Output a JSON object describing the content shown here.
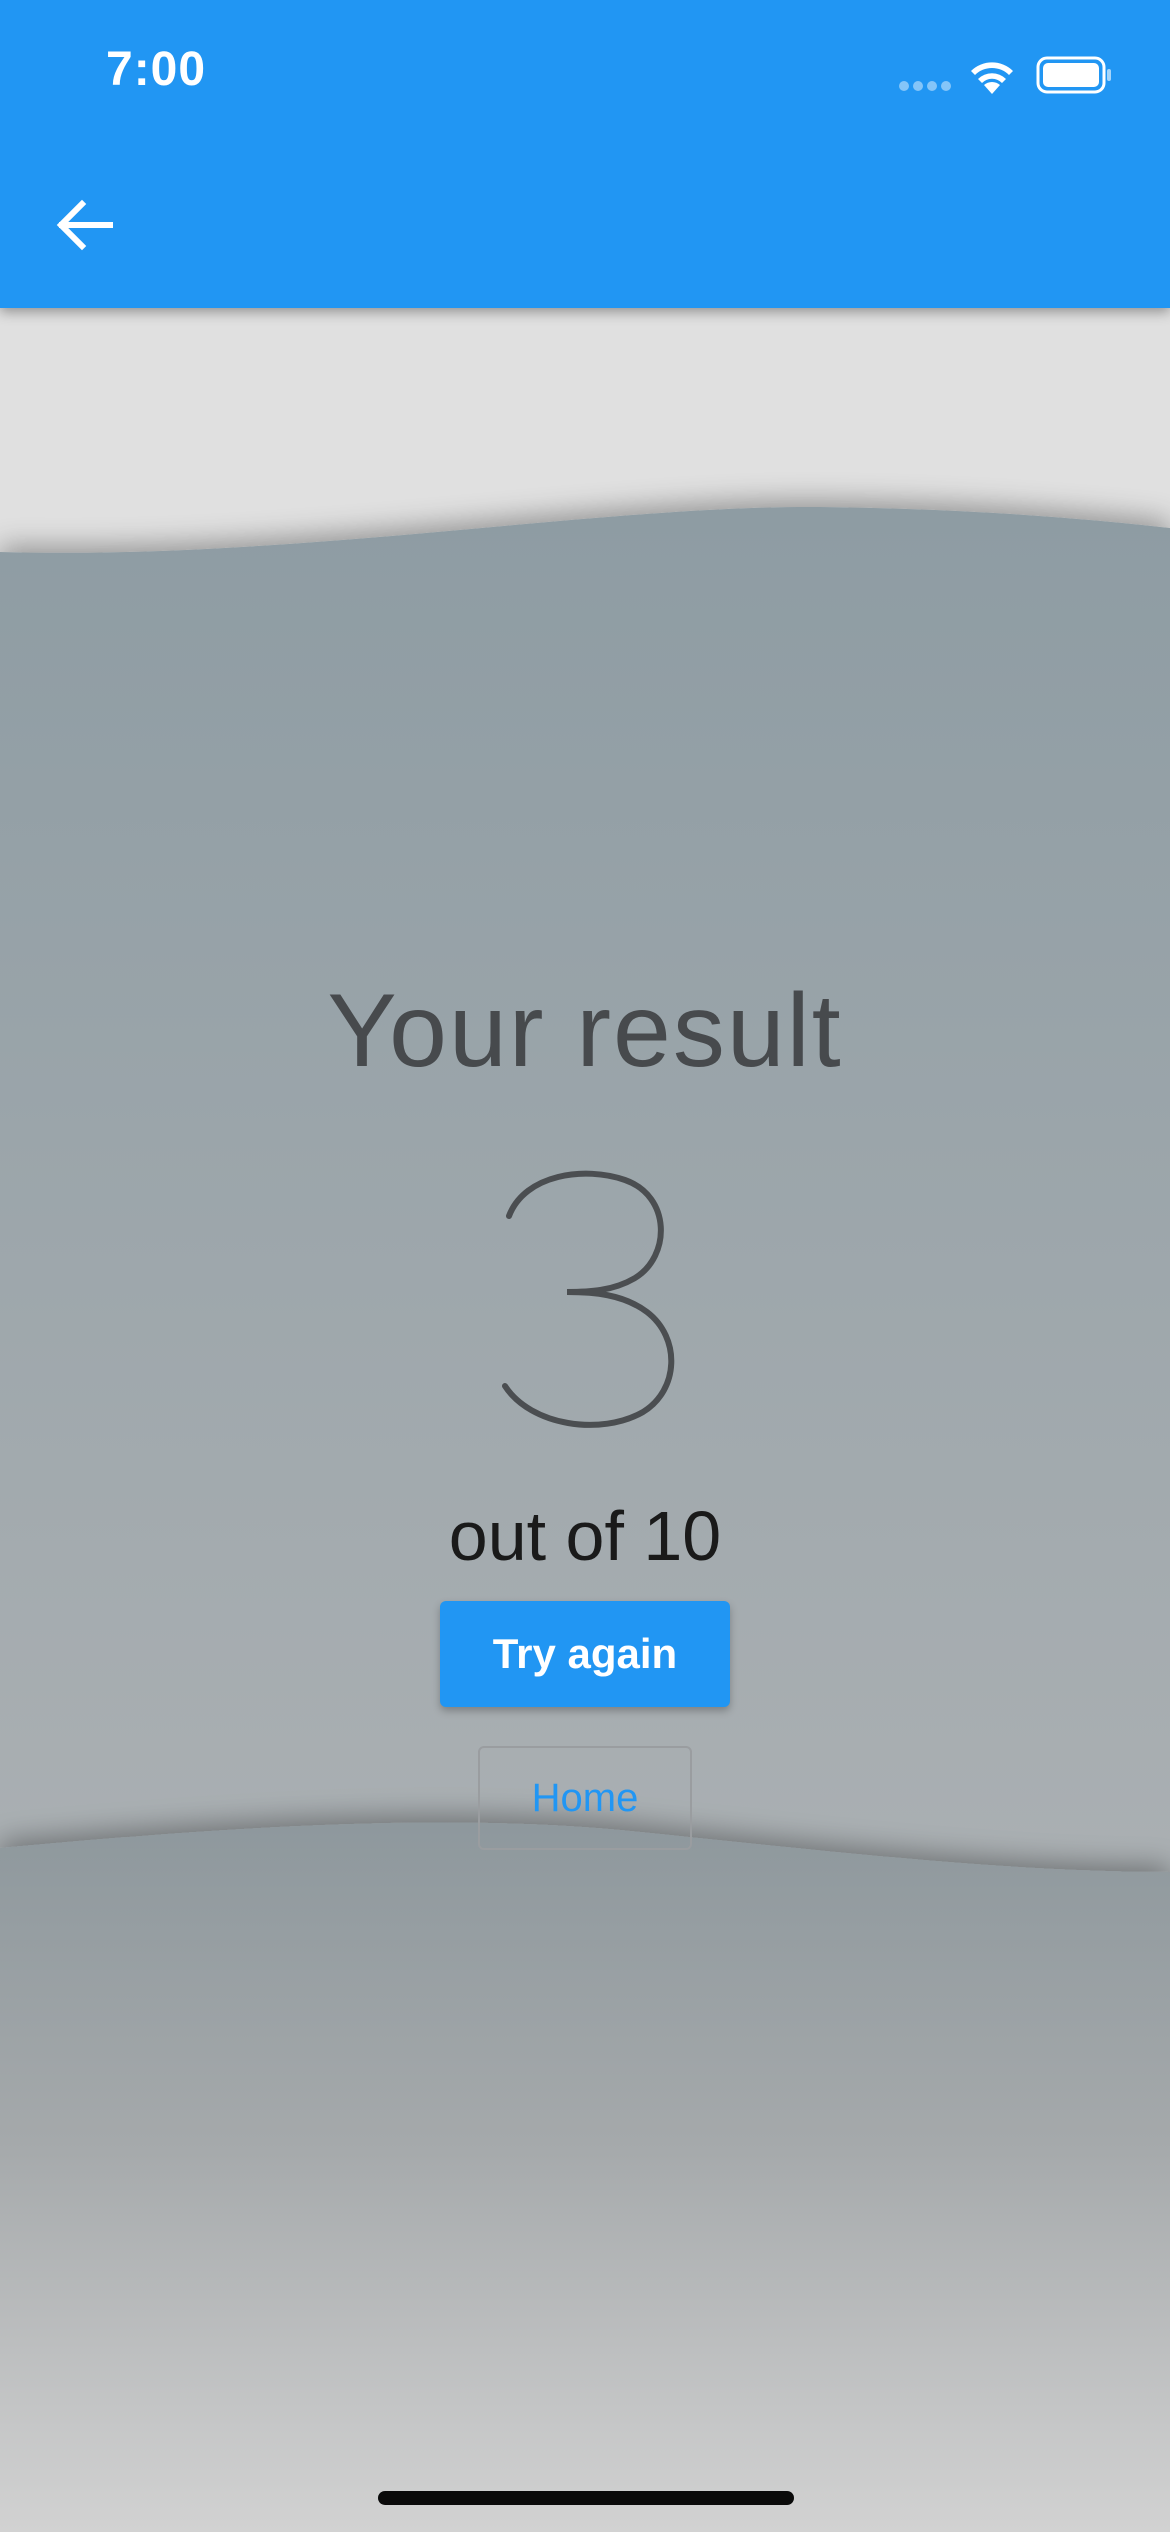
{
  "status_bar": {
    "time": "7:00"
  },
  "app_bar": {
    "back_icon": "arrow-left-icon",
    "color": "#2196f3"
  },
  "result": {
    "title": "Your result",
    "score": "3",
    "total": "out of 10"
  },
  "actions": {
    "try_again_label": "Try again",
    "home_label": "Home"
  },
  "colors": {
    "accent": "#2196f3",
    "wave_top": "#8e9aa0",
    "wave_bottom": "#cfcfcf"
  }
}
